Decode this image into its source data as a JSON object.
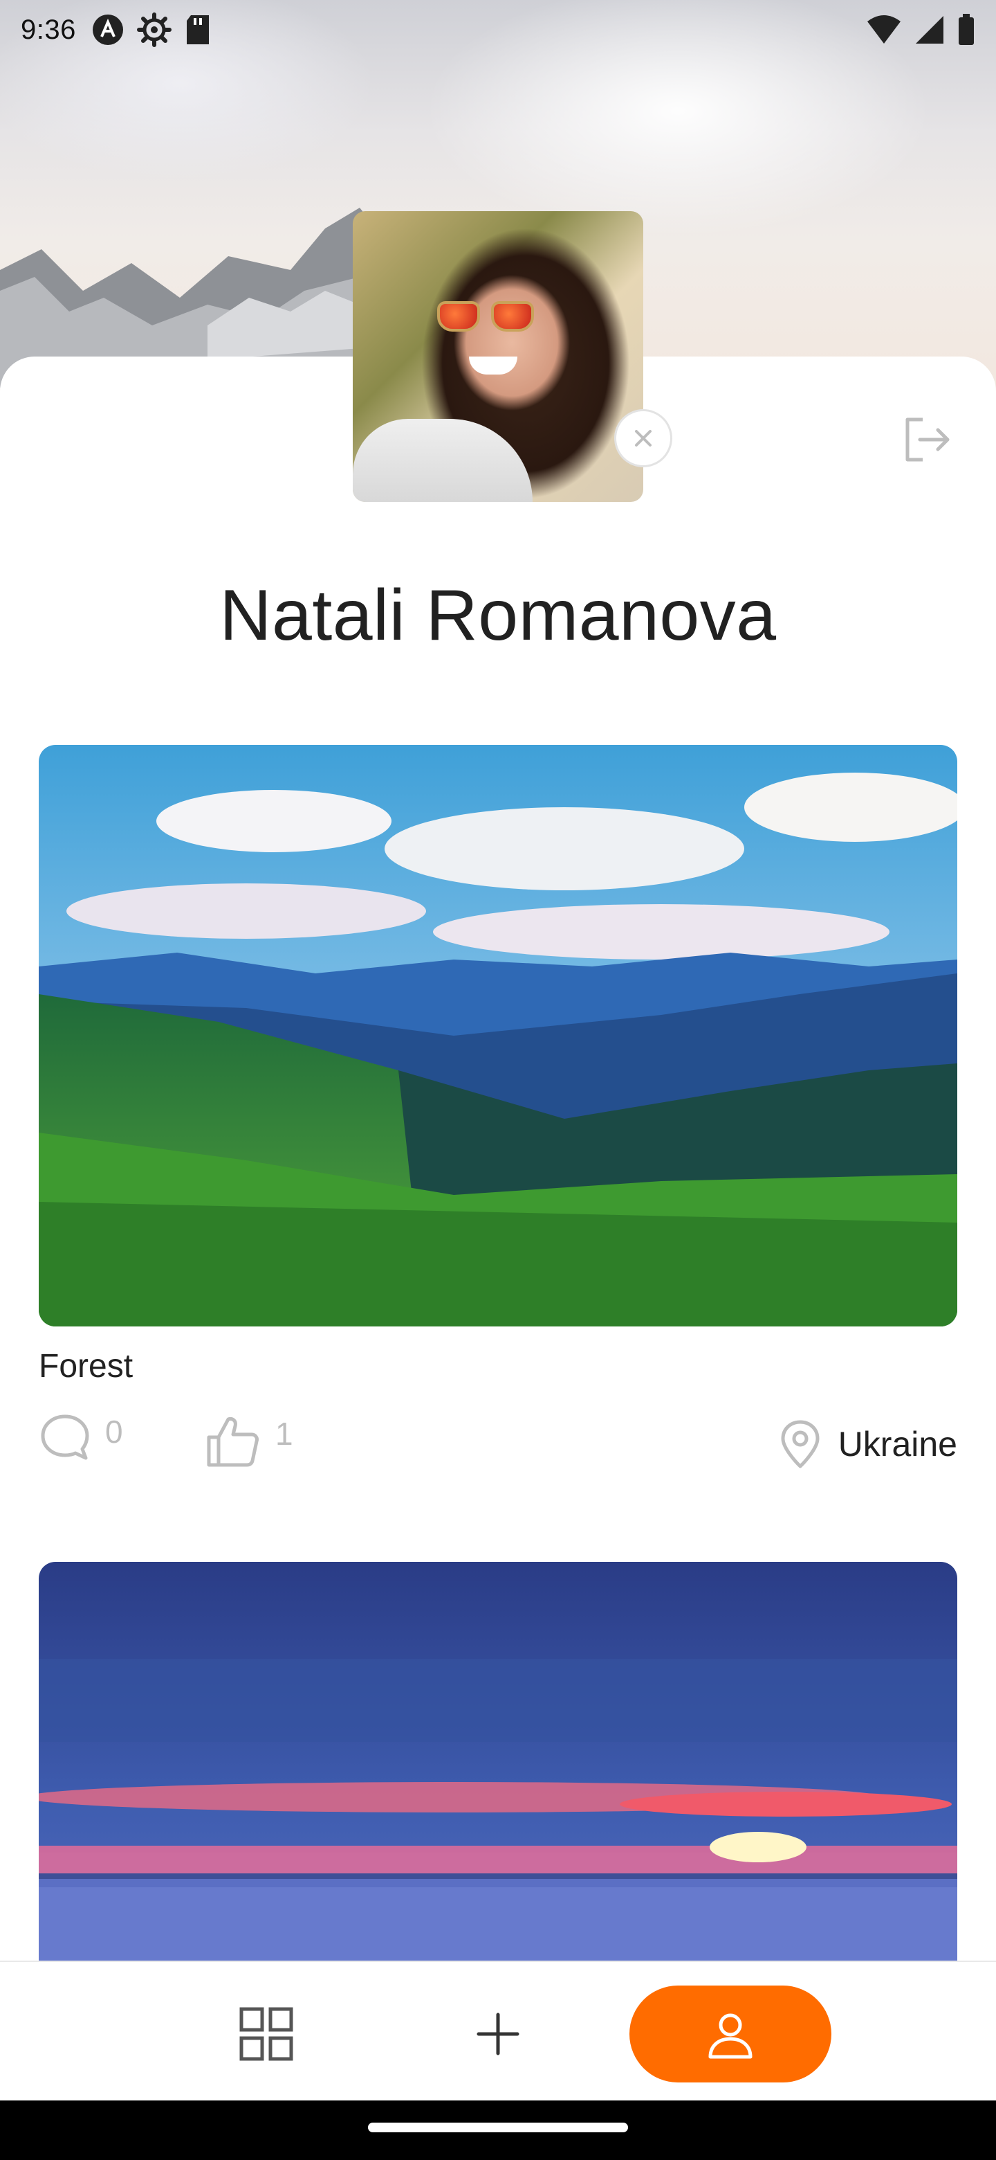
{
  "status_bar": {
    "time": "9:36",
    "left_icons": [
      "app-a-icon",
      "settings-gear-icon",
      "sd-card-icon"
    ],
    "right_icons": [
      "wifi-icon",
      "cellular-signal-icon",
      "battery-icon"
    ]
  },
  "profile": {
    "name": "Natali Romanova",
    "avatar_icon": "profile-photo",
    "remove_avatar_icon": "close-circle-icon",
    "logout_icon": "logout-icon"
  },
  "posts": [
    {
      "title": "Forest",
      "comments_count": "0",
      "likes_count": "1",
      "location": "Ukraine",
      "image": "forest-mountains-photo"
    },
    {
      "image": "sunset-sea-photo"
    }
  ],
  "bottom_nav": {
    "items": [
      "grid-icon",
      "plus-icon",
      "user-icon"
    ],
    "active": "user-icon",
    "accent_color": "#FF6C00"
  }
}
